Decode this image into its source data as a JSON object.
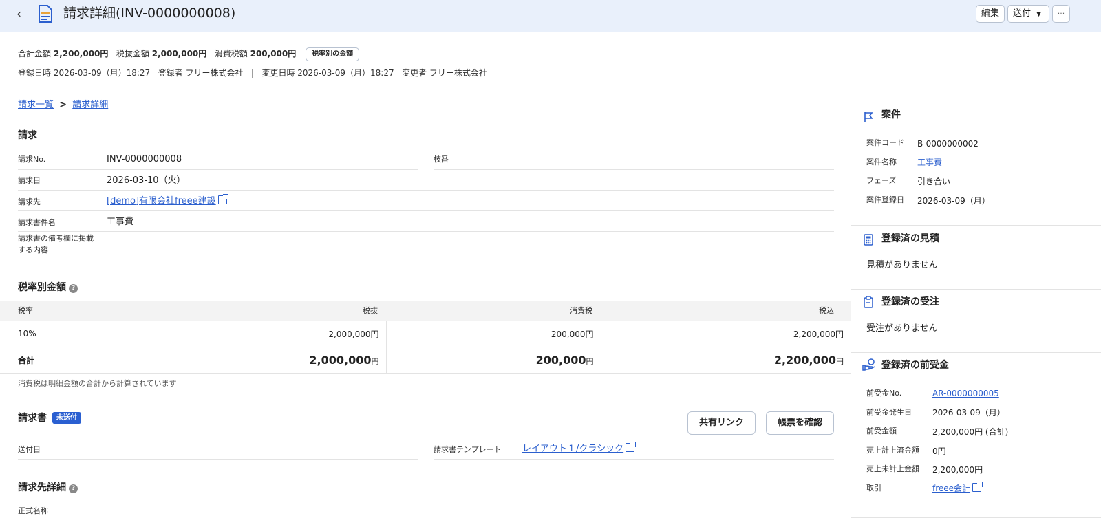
{
  "header": {
    "title": "請求詳細(INV-0000000008)",
    "edit": "編集",
    "send": "送付",
    "more": "···"
  },
  "summary": {
    "total_label": "合計金額",
    "total": "2,200,000円",
    "pretax_label": "税抜金額",
    "pretax": "2,000,000円",
    "tax_label": "消費税額",
    "tax": "200,000円",
    "rate_button": "税率別の金額"
  },
  "meta": {
    "registered_label": "登録日時",
    "registered": "2026-03-09（月）18:27",
    "registrant_label": "登録者",
    "registrant": "フリー株式会社",
    "sep": "|",
    "changed_label": "変更日時",
    "changed": "2026-03-09（月）18:27",
    "changer_label": "変更者",
    "changer": "フリー株式会社"
  },
  "breadcrumb": {
    "list": "請求一覧",
    "sep": ">",
    "current": "請求詳細"
  },
  "invoice": {
    "heading": "請求",
    "no_label": "請求No.",
    "no": "INV-0000000008",
    "branch_label": "枝番",
    "date_label": "請求日",
    "date": "2026-03-10（火）",
    "client_label": "請求先",
    "client": "[demo]有限会社freee建設",
    "subject_label": "請求書件名",
    "subject": "工事費",
    "remarks_label_1": "請求書の備考欄に掲載",
    "remarks_label_2": "する内容"
  },
  "tax_table": {
    "heading": "税率別金額",
    "help": "?",
    "headers": [
      "税率",
      "税抜",
      "消費税",
      "税込"
    ],
    "rows": [
      {
        "rate": "10%",
        "pretax": "2,000,000円",
        "tax": "200,000円",
        "total": "2,200,000円"
      }
    ],
    "total": {
      "label": "合計",
      "pretax": "2,000,000",
      "tax": "200,000",
      "total": "2,200,000",
      "unit": "円"
    },
    "note": "消費税は明細金額の合計から計算されています"
  },
  "document": {
    "heading": "請求書",
    "badge": "未送付",
    "share": "共有リンク",
    "confirm": "帳票を確認",
    "sent_label": "送付日",
    "template_label": "請求書テンプレート",
    "template": "レイアウト１/クラシック"
  },
  "client_detail": {
    "heading": "請求先詳細",
    "help": "?",
    "formal_label": "正式名称"
  },
  "project": {
    "heading": "案件",
    "code_label": "案件コード",
    "code": "B-0000000002",
    "name_label": "案件名称",
    "name": "工事費",
    "phase_label": "フェーズ",
    "phase": "引き合い",
    "date_label": "案件登録日",
    "date": "2026-03-09（月）"
  },
  "estimates": {
    "heading": "登録済の見積",
    "empty": "見積がありません"
  },
  "orders": {
    "heading": "登録済の受注",
    "empty": "受注がありません"
  },
  "advance": {
    "heading": "登録済の前受金",
    "no_label": "前受金No.",
    "no": "AR-0000000005",
    "date_label": "前受金発生日",
    "date": "2026-03-09（月）",
    "amount_label": "前受金額",
    "amount": "2,200,000円 (合計)",
    "booked_label": "売上計上済金額",
    "booked": "0円",
    "unbooked_label": "売上未計上金額",
    "unbooked": "2,200,000円",
    "deal_label": "取引",
    "deal": "freee会計"
  }
}
